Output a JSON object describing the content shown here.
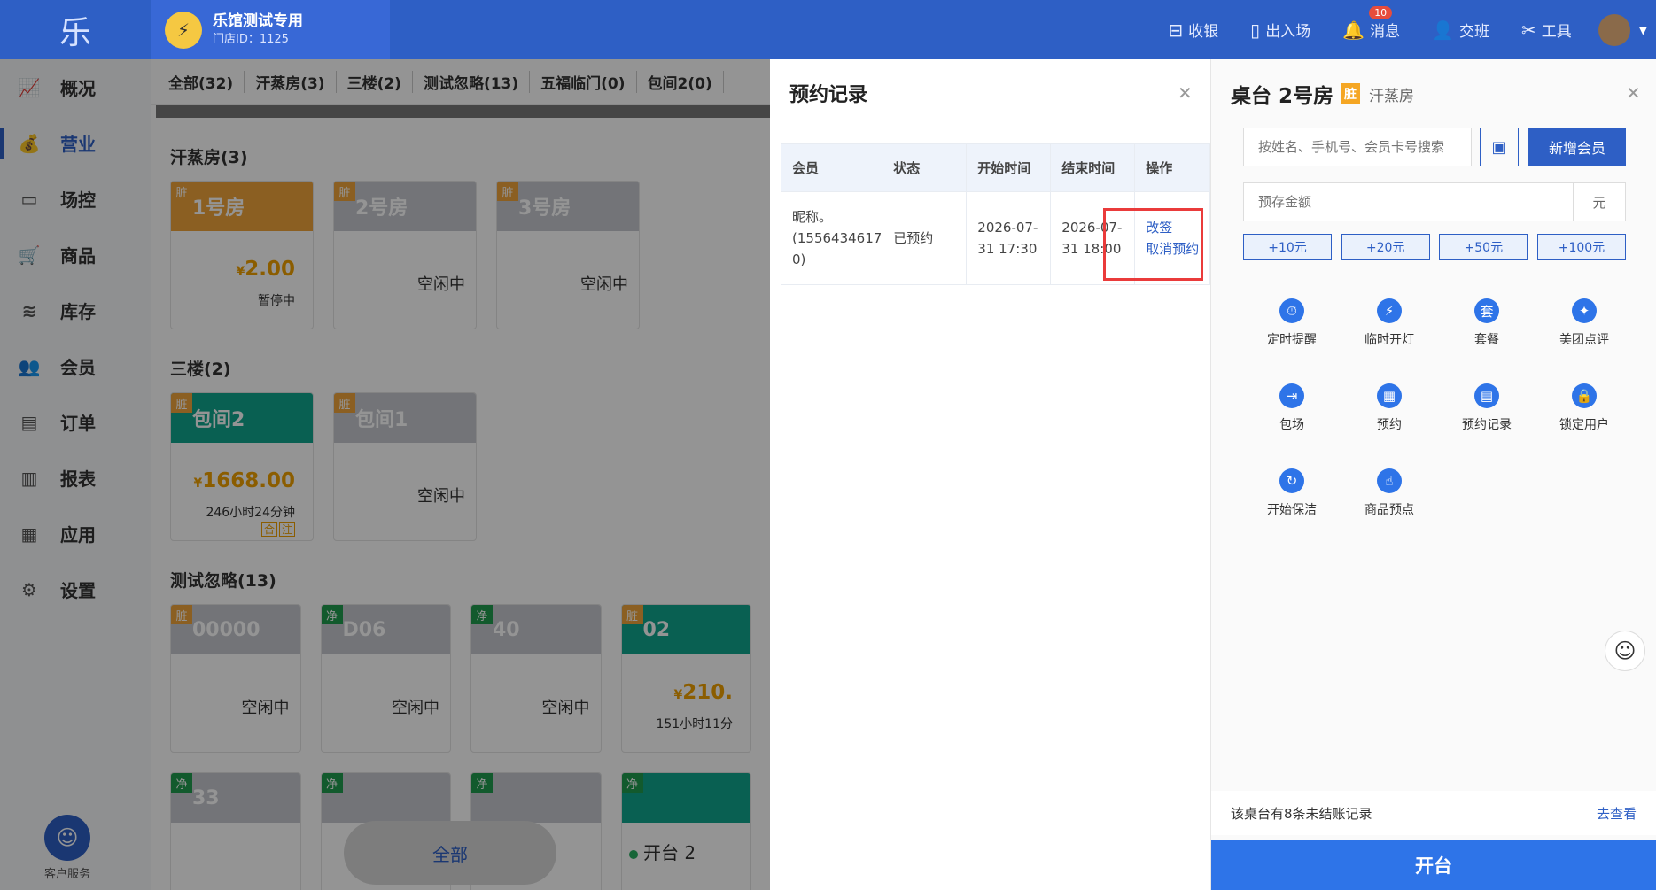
{
  "app": {
    "logo": "乐"
  },
  "store": {
    "name": "乐馆测试专用",
    "id_text": "门店ID：1125"
  },
  "top_actions": [
    {
      "label": "收银",
      "icon": "cashier-icon"
    },
    {
      "label": "出入场",
      "icon": "door-icon"
    },
    {
      "label": "消息",
      "icon": "bell-icon",
      "badge": "10"
    },
    {
      "label": "交班",
      "icon": "handover-icon"
    },
    {
      "label": "工具",
      "icon": "tools-icon"
    }
  ],
  "sidebar": {
    "items": [
      {
        "label": "概况",
        "icon": "chart-icon"
      },
      {
        "label": "营业",
        "icon": "money-bag-icon",
        "active": true
      },
      {
        "label": "场控",
        "icon": "monitor-icon"
      },
      {
        "label": "商品",
        "icon": "cart-icon"
      },
      {
        "label": "库存",
        "icon": "stack-icon"
      },
      {
        "label": "会员",
        "icon": "user-icon"
      },
      {
        "label": "订单",
        "icon": "order-icon"
      },
      {
        "label": "报表",
        "icon": "bar-chart-icon"
      },
      {
        "label": "应用",
        "icon": "apps-icon"
      },
      {
        "label": "设置",
        "icon": "gear-icon"
      }
    ],
    "support_label": "客户服务"
  },
  "categories": [
    "全部(32)",
    "汗蒸房(3)",
    "三楼(2)",
    "测试忽略(13)",
    "五福临门(0)",
    "包间2(0)"
  ],
  "sections": [
    {
      "title": "汗蒸房(3)",
      "rooms": [
        {
          "name": "1号房",
          "tag": "脏",
          "color": "orange",
          "price": "2.00",
          "sub": "暂停中"
        },
        {
          "name": "2号房",
          "tag": "脏",
          "status": "空闲中"
        },
        {
          "name": "3号房",
          "tag": "脏",
          "status": "空闲中"
        }
      ]
    },
    {
      "title": "三楼(2)",
      "rooms": [
        {
          "name": "包间2",
          "tag": "脏",
          "color": "teal",
          "price": "1668.00",
          "sub": "246小时24分钟",
          "badges": [
            "合",
            "注"
          ]
        },
        {
          "name": "包间1",
          "tag": "脏",
          "status": "空闲中"
        }
      ]
    },
    {
      "title": "测试忽略(13)",
      "rooms": [
        {
          "name": "00000",
          "tag": "脏",
          "status": "空闲中"
        },
        {
          "name": "D06",
          "tag": "净",
          "status": "空闲中"
        },
        {
          "name": "40",
          "tag": "净",
          "status": "空闲中"
        },
        {
          "name": "02",
          "tag": "脏",
          "color": "teal",
          "price": "210.",
          "sub": "151小时11分"
        }
      ]
    }
  ],
  "row4_rooms": [
    {
      "name": "33",
      "tag": "净"
    },
    {
      "tag": "净"
    },
    {
      "tag": "净"
    },
    {
      "tag": "净"
    }
  ],
  "bottom": {
    "all_label": "全部",
    "open_label": "开台 2"
  },
  "booking": {
    "title": "预约记录",
    "columns": [
      "会员",
      "状态",
      "开始时间",
      "结束时间",
      "操作"
    ],
    "rows": [
      {
        "member": "昵称。(1556434617 0)",
        "status": "已预约",
        "start": "2026-07-31 17:30",
        "end": "2026-07-31 18:00",
        "actions": [
          "改签",
          "取消预约"
        ]
      }
    ]
  },
  "detail": {
    "title": "桌台 2号房",
    "tag": "脏",
    "category": "汗蒸房",
    "search_placeholder": "按姓名、手机号、会员卡号搜索",
    "new_member": "新增会员",
    "amount_placeholder": "预存金额",
    "unit": "元",
    "quick": [
      "+10元",
      "+20元",
      "+50元",
      "+100元"
    ],
    "actions": [
      {
        "label": "定时提醒",
        "icon": "timer-icon",
        "glyph": "⏱"
      },
      {
        "label": "临时开灯",
        "icon": "lightning-icon",
        "glyph": "⚡"
      },
      {
        "label": "套餐",
        "icon": "package-icon",
        "glyph": "套"
      },
      {
        "label": "美团点评",
        "icon": "meituan-icon",
        "glyph": "✦"
      },
      {
        "label": "包场",
        "icon": "enter-icon",
        "glyph": "⇥"
      },
      {
        "label": "预约",
        "icon": "calendar-icon",
        "glyph": "▦"
      },
      {
        "label": "预约记录",
        "icon": "calendar-clock-icon",
        "glyph": "▤"
      },
      {
        "label": "锁定用户",
        "icon": "lock-icon",
        "glyph": "🔒"
      },
      {
        "label": "开始保洁",
        "icon": "refresh-icon",
        "glyph": "↻"
      },
      {
        "label": "商品预点",
        "icon": "hand-pointer-icon",
        "glyph": "☝"
      }
    ],
    "record_text": "该桌台有8条未结账记录",
    "record_link": "去查看",
    "open_button": "开台"
  }
}
